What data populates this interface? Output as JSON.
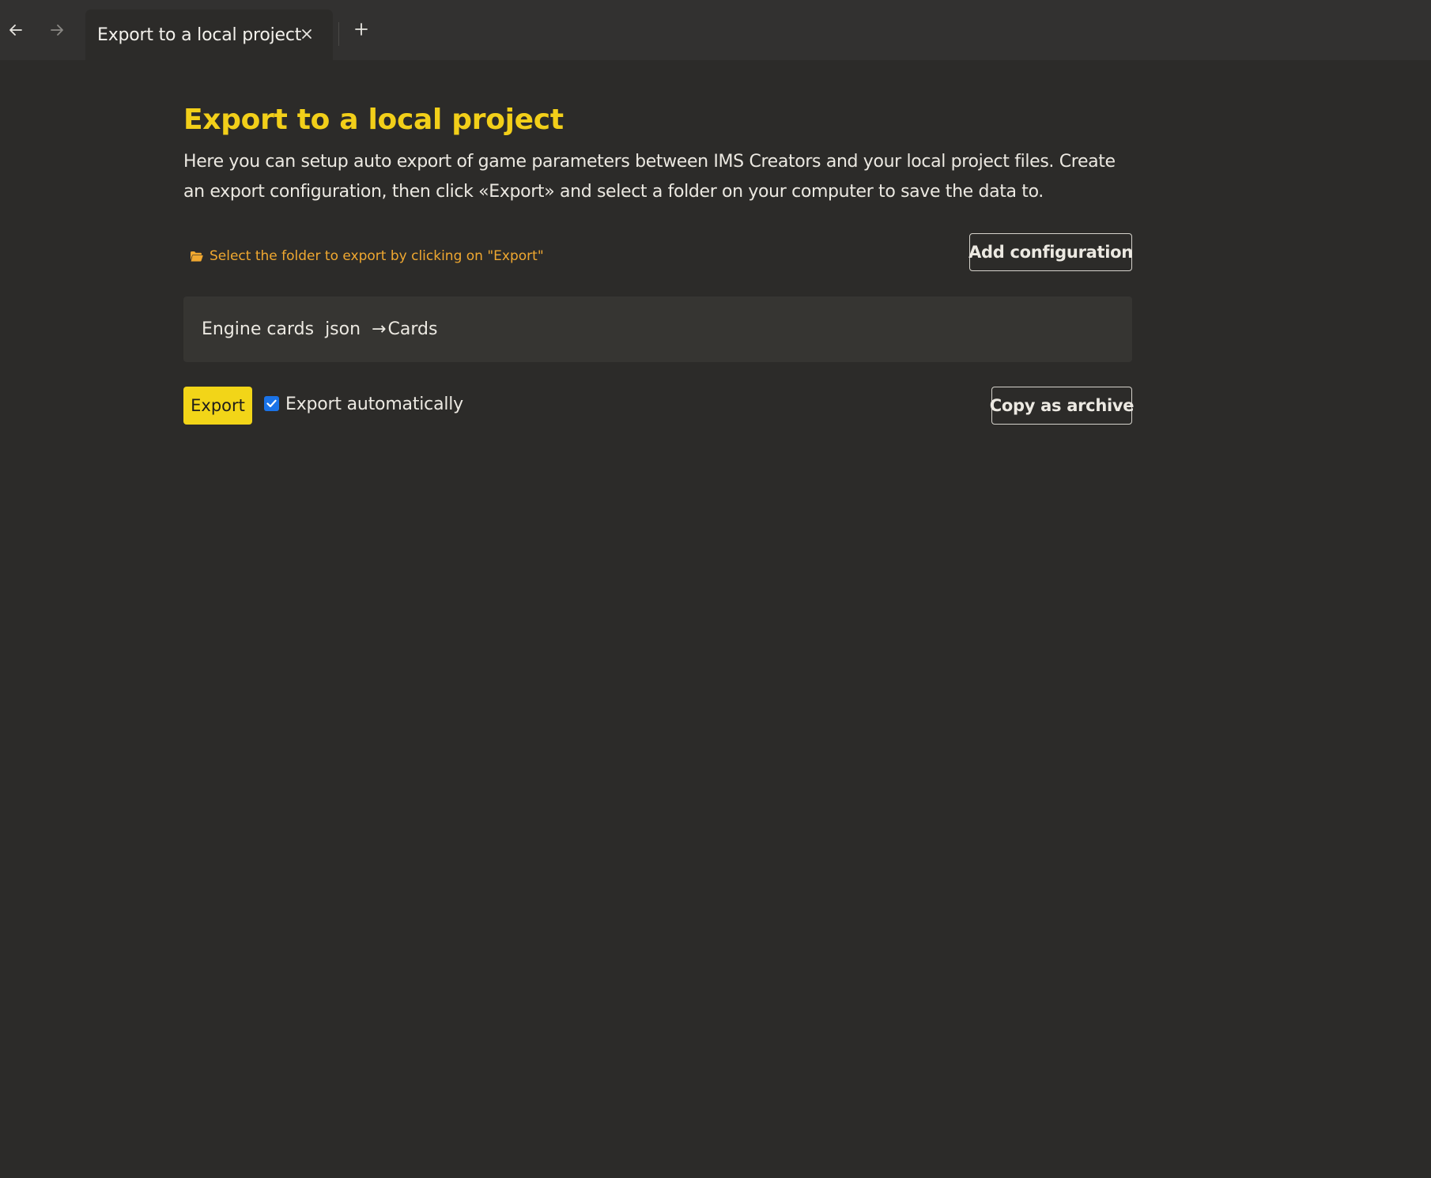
{
  "tabbar": {
    "back_icon": "arrow-left-icon",
    "forward_icon": "arrow-right-icon",
    "tabs": [
      {
        "label": "Export to a local project",
        "active": true
      }
    ],
    "close_icon": "close-icon",
    "add_icon": "plus-icon"
  },
  "page": {
    "title": "Export to a local project",
    "description": "Here you can setup auto export of game parameters between IMS Creators and your local project files. Create an export configuration, then click «Export» and select a folder on your computer to save the data to.",
    "hint": {
      "icon": "folder-open-icon",
      "text": "Select the folder to export by clicking on \"Export\""
    },
    "add_configuration_label": "Add configuration",
    "configurations": [
      {
        "name": "Engine cards",
        "format": "json",
        "arrow": "→",
        "target": "Cards"
      }
    ],
    "export_label": "Export",
    "auto_export": {
      "label": "Export automatically",
      "checked": true
    },
    "copy_archive_label": "Copy as archive"
  },
  "colors": {
    "background": "#2c2b29",
    "tabbar": "#323130",
    "accent_yellow": "#f2d518",
    "title_yellow": "#f2cf19",
    "hint_orange": "#f0a830",
    "checkbox_blue": "#1a73e8",
    "config_row_bg": "#363532"
  }
}
